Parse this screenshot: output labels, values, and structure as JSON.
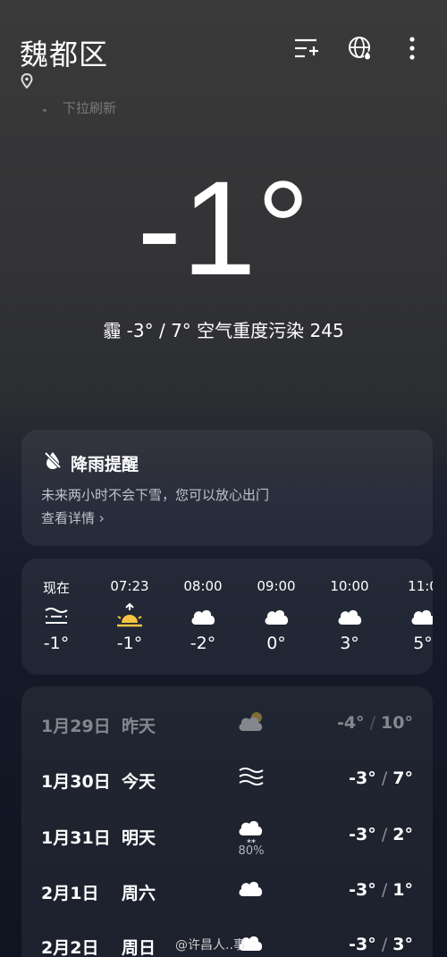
{
  "header": {
    "city": "魏都区",
    "refresh_hint": "下拉刷新",
    "icons": [
      "location-pin-icon",
      "add-city-icon",
      "globe-icon",
      "more-icon"
    ]
  },
  "current": {
    "temperature": "-1°",
    "summary": "霾  -3° / 7°  空气重度污染 245"
  },
  "rain_alert": {
    "title": "降雨提醒",
    "description": "未来两小时不会下雪，您可以放心出门",
    "link": "查看详情 ›"
  },
  "hourly": [
    {
      "time": "现在",
      "icon": "haze-icon",
      "temp": "-1°"
    },
    {
      "time": "07:23",
      "icon": "sunrise-icon",
      "temp": "-1°"
    },
    {
      "time": "08:00",
      "icon": "cloud-icon",
      "temp": "-2°"
    },
    {
      "time": "09:00",
      "icon": "cloud-icon",
      "temp": "0°"
    },
    {
      "time": "10:00",
      "icon": "cloud-icon",
      "temp": "3°"
    },
    {
      "time": "11:0",
      "icon": "cloud-icon",
      "temp": "5°"
    }
  ],
  "daily": [
    {
      "date": "1月29日",
      "day": "昨天",
      "icon": "partly-cloudy-icon",
      "low": "-4°",
      "high": "10°",
      "precip": ""
    },
    {
      "date": "1月30日",
      "day": "今天",
      "icon": "haze-icon",
      "low": "-3°",
      "high": "7°",
      "precip": ""
    },
    {
      "date": "1月31日",
      "day": "明天",
      "icon": "snow-icon",
      "low": "-3°",
      "high": "2°",
      "precip": "80%"
    },
    {
      "date": "2月1日",
      "day": "周六",
      "icon": "cloud-icon",
      "low": "-3°",
      "high": "1°",
      "precip": ""
    },
    {
      "date": "2月2日",
      "day": "周日",
      "icon": "cloud-icon",
      "low": "-3°",
      "high": "3°",
      "precip": ""
    }
  ],
  "watermark": "@许昌人..事"
}
